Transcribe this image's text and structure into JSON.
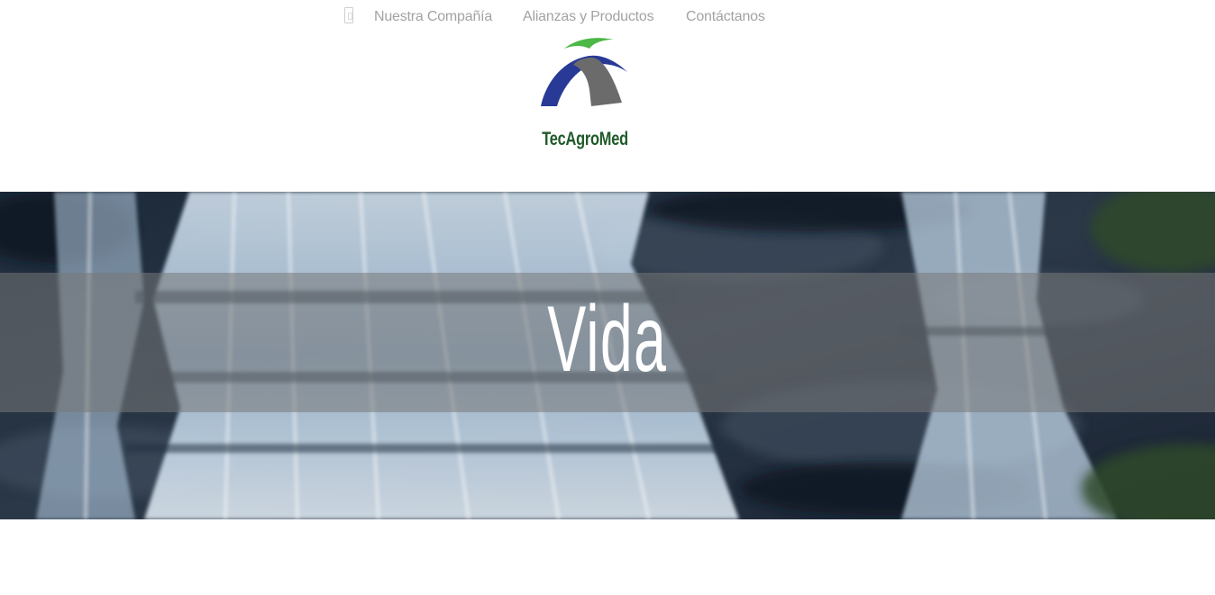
{
  "nav": {
    "home_icon": "page-icon",
    "items": [
      {
        "label": "Nuestra Compañía"
      },
      {
        "label": "Alianzas y Productos"
      },
      {
        "label": "Contáctanos"
      }
    ]
  },
  "logo": {
    "name": "TecAgroMed",
    "colors": {
      "green": "#4cb848",
      "blue": "#283a96",
      "gray": "#6b6b6b",
      "text": "#1f5a2a"
    }
  },
  "hero": {
    "title": "Vida",
    "image": "waterfall"
  }
}
